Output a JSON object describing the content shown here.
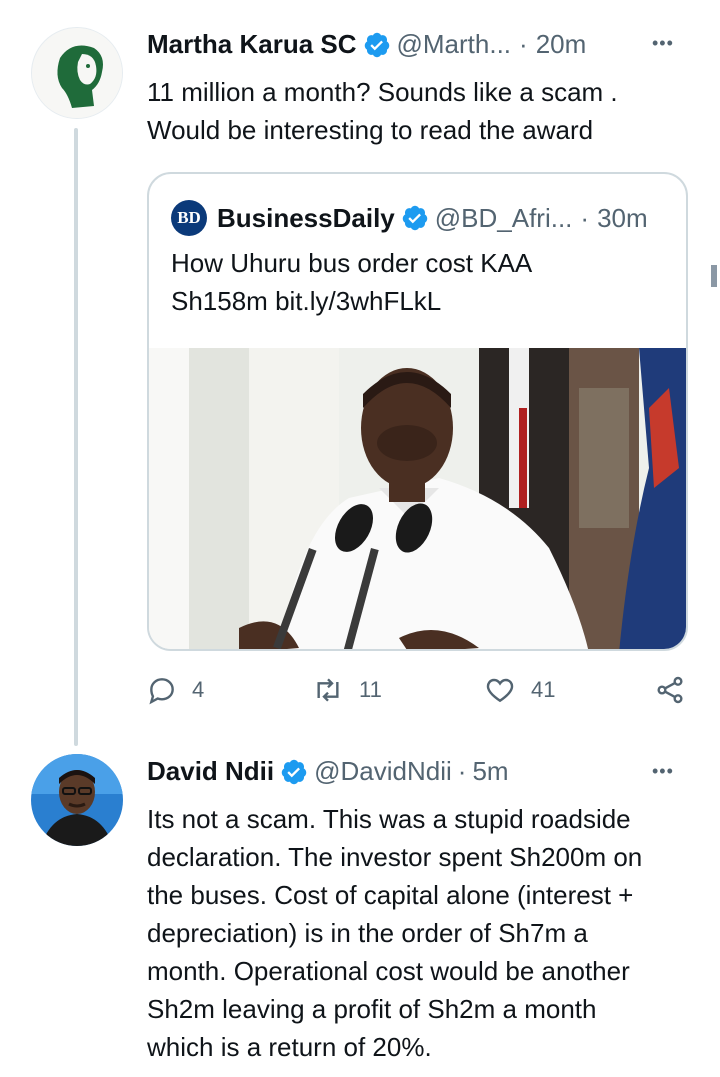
{
  "tweets": [
    {
      "name": "Martha Karua SC",
      "handle": "@Marth...",
      "time": "20m",
      "text_lines": [
        "11 million a month? Sounds like a scam .",
        "Would be interesting to read the award"
      ],
      "quote": {
        "name": "BusinessDaily",
        "logo_text": "BD",
        "handle": "@BD_Afri...",
        "time": "30m",
        "text_lines": [
          "How Uhuru bus order cost KAA",
          "Sh158m bit.ly/3whFLkL"
        ]
      },
      "actions": {
        "replies": "4",
        "retweets": "11",
        "likes": "41"
      }
    },
    {
      "name": "David Ndii",
      "handle": "@DavidNdii",
      "time": "5m",
      "text_lines": [
        "Its not a scam. This was a stupid roadside",
        "declaration. The investor spent Sh200m on",
        "the buses. Cost of capital alone (interest +",
        "depreciation) is in the order of Sh7m a",
        "month. Operational cost would be another",
        "Sh2m leaving a profit of Sh2m a month",
        "which is a return of 20%."
      ]
    }
  ],
  "separator": "·",
  "more_glyph": "•••",
  "colors": {
    "verified": "#1d9bf0",
    "secondary": "#536471",
    "border": "#cfd9de"
  }
}
